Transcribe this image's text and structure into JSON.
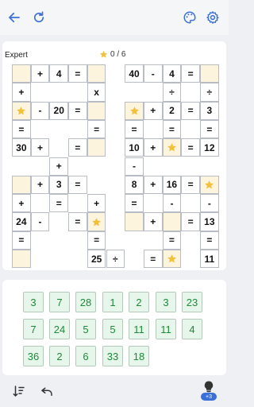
{
  "header": {
    "back_icon": "arrow-left-icon",
    "restart_icon": "refresh-icon",
    "theme_icon": "palette-icon",
    "settings_icon": "gear-icon"
  },
  "game": {
    "difficulty": "Expert",
    "stars_progress": "0 / 6",
    "star_icon": "star-icon",
    "colors": {
      "empty_cell": "#fcf4dd",
      "star": "#f2c13c",
      "tile_bg": "#e6f6ea",
      "tile_text": "#1e8a3a",
      "accent": "#3a6fd9"
    }
  },
  "board": {
    "cells": [
      {
        "t": "e"
      },
      {
        "t": "o",
        "v": "+"
      },
      {
        "t": "n",
        "v": "4"
      },
      {
        "t": "o",
        "v": "="
      },
      {
        "t": "e"
      },
      {
        "t": "n",
        "v": "40"
      },
      {
        "t": "o",
        "v": "-"
      },
      {
        "t": "n",
        "v": "4"
      },
      {
        "t": "o",
        "v": "="
      },
      {
        "t": "e"
      },
      {
        "t": "o",
        "v": "+"
      },
      {
        "t": "o",
        "v": "x"
      },
      {
        "t": "o",
        "v": "÷"
      },
      {
        "t": "o",
        "v": "÷"
      },
      {
        "t": "s"
      },
      {
        "t": "o",
        "v": "-"
      },
      {
        "t": "n",
        "v": "20"
      },
      {
        "t": "o",
        "v": "="
      },
      {
        "t": "e"
      },
      {
        "t": "s"
      },
      {
        "t": "o",
        "v": "+"
      },
      {
        "t": "n",
        "v": "2"
      },
      {
        "t": "o",
        "v": "="
      },
      {
        "t": "n",
        "v": "3"
      },
      {
        "t": "o",
        "v": "="
      },
      {
        "t": "o",
        "v": "="
      },
      {
        "t": "o",
        "v": "="
      },
      {
        "t": "o",
        "v": "="
      },
      {
        "t": "o",
        "v": "="
      },
      {
        "t": "n",
        "v": "30"
      },
      {
        "t": "o",
        "v": "+"
      },
      {
        "t": "o",
        "v": "="
      },
      {
        "t": "e"
      },
      {
        "t": "n",
        "v": "10"
      },
      {
        "t": "o",
        "v": "+"
      },
      {
        "t": "s"
      },
      {
        "t": "o",
        "v": "="
      },
      {
        "t": "n",
        "v": "12"
      },
      {
        "t": "o",
        "v": "+"
      },
      {
        "t": "o",
        "v": "-"
      },
      {
        "t": "e"
      },
      {
        "t": "o",
        "v": "+"
      },
      {
        "t": "n",
        "v": "3"
      },
      {
        "t": "o",
        "v": "="
      },
      {
        "t": "n",
        "v": "8"
      },
      {
        "t": "o",
        "v": "+"
      },
      {
        "t": "n",
        "v": "16"
      },
      {
        "t": "o",
        "v": "="
      },
      {
        "t": "s"
      },
      {
        "t": "o",
        "v": "+"
      },
      {
        "t": "o",
        "v": "="
      },
      {
        "t": "o",
        "v": "+"
      },
      {
        "t": "o",
        "v": "="
      },
      {
        "t": "o",
        "v": "-"
      },
      {
        "t": "o",
        "v": "-"
      },
      {
        "t": "n",
        "v": "24"
      },
      {
        "t": "o",
        "v": "-"
      },
      {
        "t": "o",
        "v": "="
      },
      {
        "t": "s"
      },
      {
        "t": "e"
      },
      {
        "t": "o",
        "v": "+"
      },
      {
        "t": "e"
      },
      {
        "t": "o",
        "v": "="
      },
      {
        "t": "n",
        "v": "13"
      },
      {
        "t": "o",
        "v": "="
      },
      {
        "t": "o",
        "v": "="
      },
      {
        "t": "o",
        "v": "="
      },
      {
        "t": "o",
        "v": "="
      },
      {
        "t": "e"
      },
      {
        "t": "n",
        "v": "25"
      },
      {
        "t": "o",
        "v": "÷"
      },
      {
        "t": "o",
        "v": "="
      },
      {
        "t": "s"
      },
      {
        "t": "n",
        "v": "11"
      }
    ]
  },
  "pool": {
    "tiles": [
      "3",
      "7",
      "28",
      "1",
      "2",
      "3",
      "23",
      "7",
      "24",
      "5",
      "5",
      "11",
      "11",
      "4",
      "36",
      "2",
      "6",
      "33",
      "18"
    ]
  },
  "footer": {
    "sort_icon": "sort-icon",
    "undo_icon": "undo-icon",
    "hint_icon": "lightbulb-icon",
    "hint_count": "+3"
  }
}
